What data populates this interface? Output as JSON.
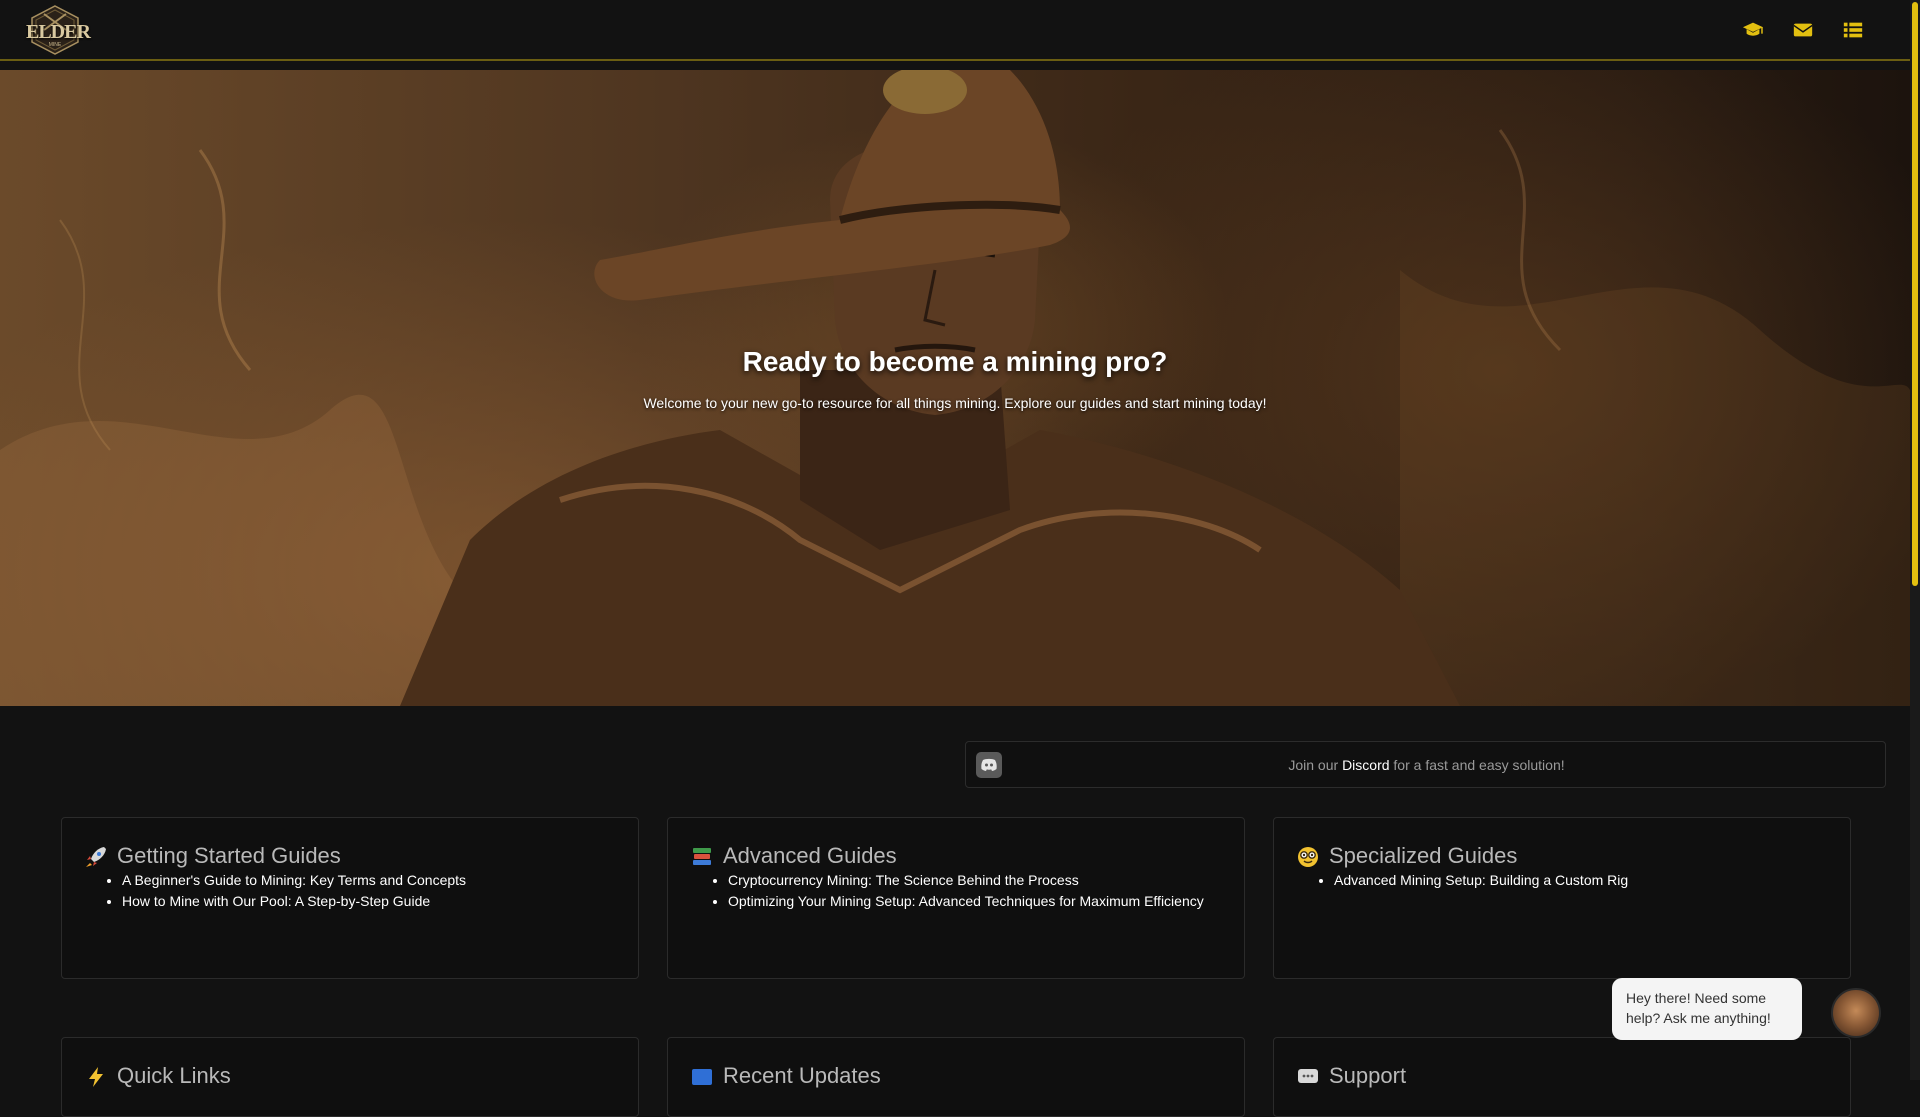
{
  "header": {
    "logo_text": "ELDER",
    "logo_sub": "MINE",
    "icons": [
      "graduation-cap-icon",
      "envelope-icon",
      "list-icon"
    ],
    "accent_color": "#e2bf10"
  },
  "hero": {
    "title": "Ready to become a mining pro?",
    "subtitle": "Welcome to your new go-to resource for all things mining. Explore our guides and start mining today!"
  },
  "discord": {
    "prefix": "Join our ",
    "link": "Discord",
    "suffix": " for a fast and easy solution!"
  },
  "cards": [
    {
      "icon": "rocket-icon",
      "title": "Getting Started Guides",
      "items": [
        "A Beginner's Guide to Mining: Key Terms and Concepts",
        "How to Mine with Our Pool: A Step-by-Step Guide"
      ]
    },
    {
      "icon": "books-icon",
      "title": "Advanced Guides",
      "items": [
        "Cryptocurrency Mining: The Science Behind the Process",
        "Optimizing Your Mining Setup: Advanced Techniques for Maximum Efficiency"
      ]
    },
    {
      "icon": "nerd-face-icon",
      "title": "Specialized Guides",
      "items": [
        "Advanced Mining Setup: Building a Custom Rig"
      ]
    }
  ],
  "cards_row2": [
    {
      "icon": "lightning-icon",
      "title": "Quick Links"
    },
    {
      "icon": "new-badge-icon",
      "title": "Recent Updates"
    },
    {
      "icon": "speech-bubble-icon",
      "title": "Support"
    }
  ],
  "chat": {
    "message": "Hey there! Need some help? Ask me anything!"
  }
}
